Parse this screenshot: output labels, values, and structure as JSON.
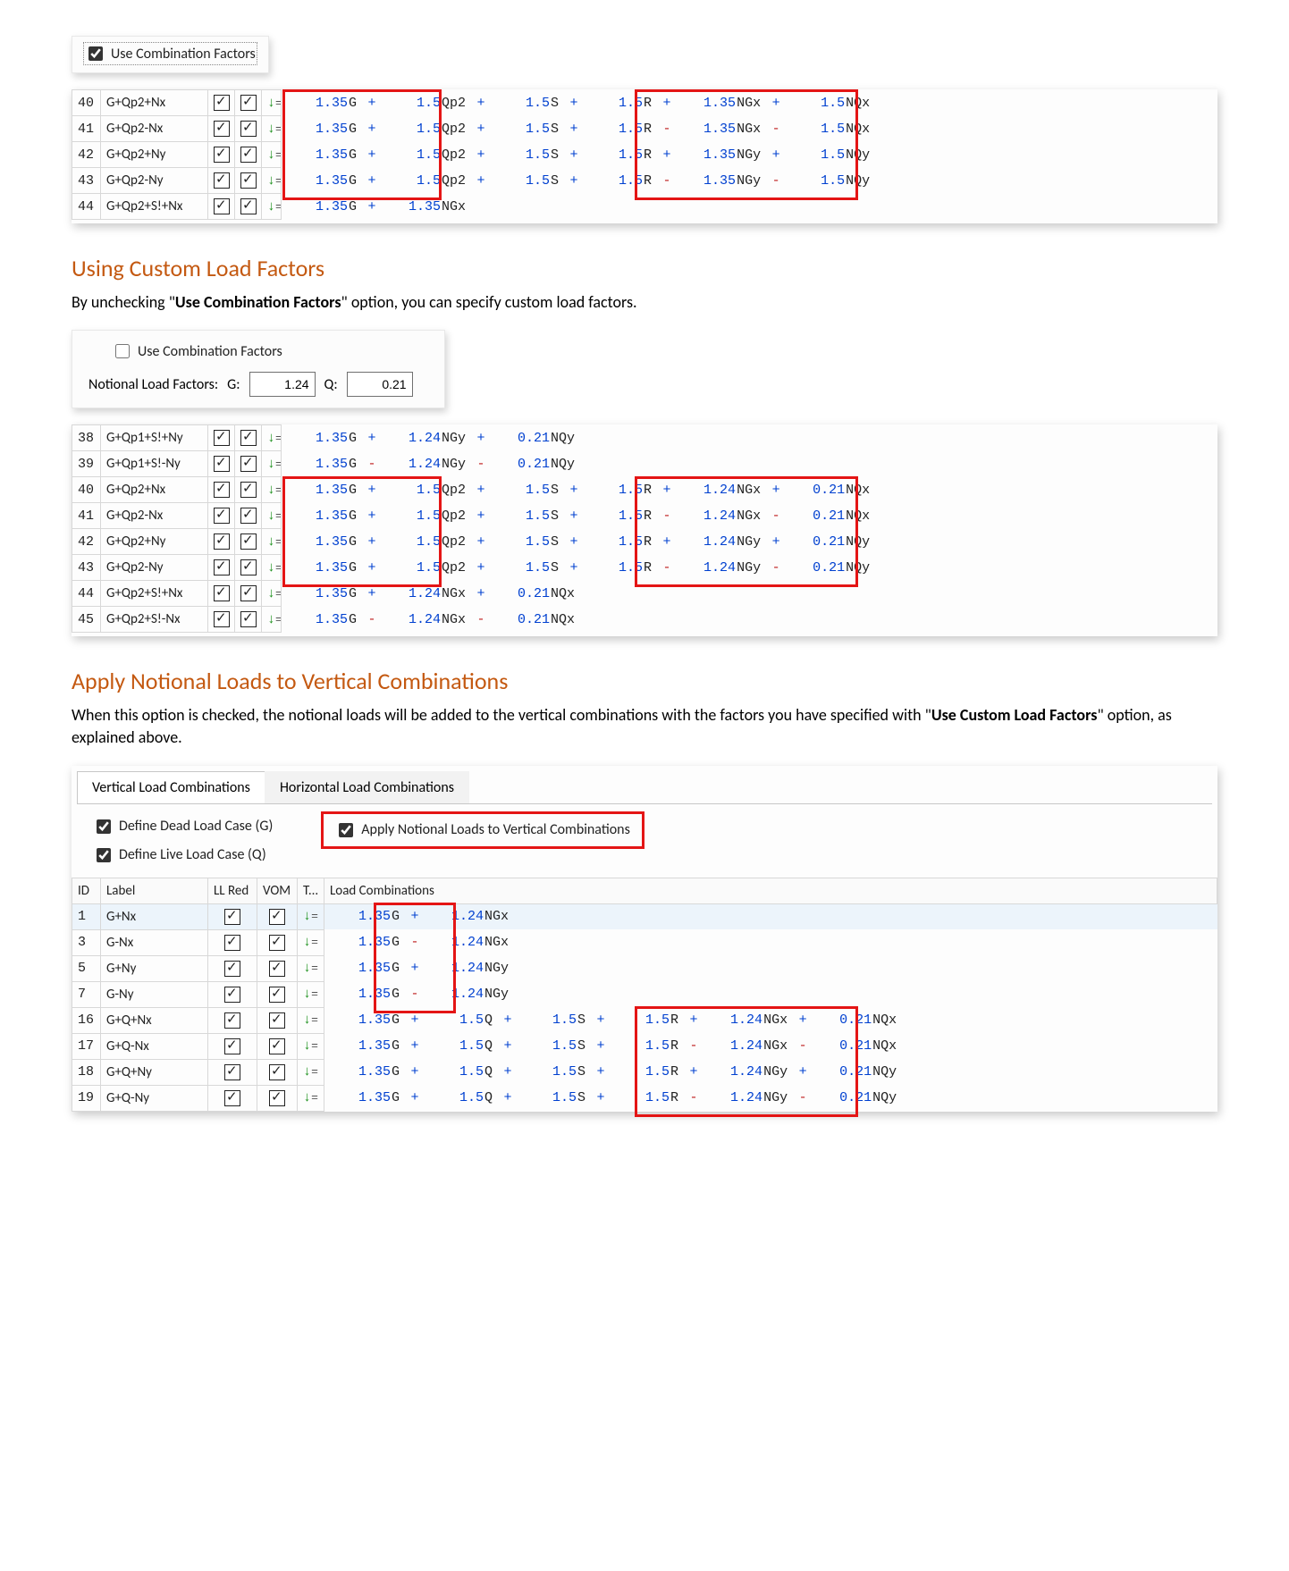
{
  "top_checkbox": {
    "label": "Use Combination Factors",
    "checked": true
  },
  "table1_rows": [
    {
      "id": "40",
      "label": "G+Qp2+Nx",
      "expr": [
        [
          "+",
          "1.35",
          "G"
        ],
        [
          "+",
          "1.5",
          "Qp2"
        ],
        [
          "+",
          "1.5",
          "S"
        ],
        [
          "+",
          "1.5",
          "R"
        ],
        [
          "+",
          "1.35",
          "NGx"
        ],
        [
          "+",
          "1.5",
          "NQx"
        ]
      ]
    },
    {
      "id": "41",
      "label": "G+Qp2-Nx",
      "expr": [
        [
          "+",
          "1.35",
          "G"
        ],
        [
          "+",
          "1.5",
          "Qp2"
        ],
        [
          "+",
          "1.5",
          "S"
        ],
        [
          "+",
          "1.5",
          "R"
        ],
        [
          "-",
          "1.35",
          "NGx"
        ],
        [
          "-",
          "1.5",
          "NQx"
        ]
      ]
    },
    {
      "id": "42",
      "label": "G+Qp2+Ny",
      "expr": [
        [
          "+",
          "1.35",
          "G"
        ],
        [
          "+",
          "1.5",
          "Qp2"
        ],
        [
          "+",
          "1.5",
          "S"
        ],
        [
          "+",
          "1.5",
          "R"
        ],
        [
          "+",
          "1.35",
          "NGy"
        ],
        [
          "+",
          "1.5",
          "NQy"
        ]
      ]
    },
    {
      "id": "43",
      "label": "G+Qp2-Ny",
      "expr": [
        [
          "+",
          "1.35",
          "G"
        ],
        [
          "+",
          "1.5",
          "Qp2"
        ],
        [
          "+",
          "1.5",
          "S"
        ],
        [
          "+",
          "1.5",
          "R"
        ],
        [
          "-",
          "1.35",
          "NGy"
        ],
        [
          "-",
          "1.5",
          "NQy"
        ]
      ]
    },
    {
      "id": "44",
      "label": "G+Qp2+S!+Nx",
      "expr": [
        [
          "+",
          "1.35",
          "G"
        ],
        [
          "+",
          "1.35",
          "NGx"
        ]
      ]
    }
  ],
  "section1": {
    "heading": "Using Custom Load Factors",
    "body_prefix": "By unchecking \"",
    "body_bold": "Use Combination Factors",
    "body_suffix": "\" option, you can specify custom load factors."
  },
  "custom_panel": {
    "checkbox": "Use Combination Factors",
    "checkbox_checked": false,
    "nf_label": "Notional Load Factors:",
    "g_label": "G:",
    "g_val": "1.24",
    "q_label": "Q:",
    "q_val": "0.21"
  },
  "table2_rows": [
    {
      "id": "38",
      "label": "G+Qp1+S!+Ny",
      "expr": [
        [
          "+",
          "1.35",
          "G"
        ],
        [
          "+",
          "1.24",
          "NGy"
        ],
        [
          "+",
          "0.21",
          "NQy"
        ]
      ]
    },
    {
      "id": "39",
      "label": "G+Qp1+S!-Ny",
      "expr": [
        [
          "+",
          "1.35",
          "G"
        ],
        [
          "-",
          "1.24",
          "NGy"
        ],
        [
          "-",
          "0.21",
          "NQy"
        ]
      ]
    },
    {
      "id": "40",
      "label": "G+Qp2+Nx",
      "expr": [
        [
          "+",
          "1.35",
          "G"
        ],
        [
          "+",
          "1.5",
          "Qp2"
        ],
        [
          "+",
          "1.5",
          "S"
        ],
        [
          "+",
          "1.5",
          "R"
        ],
        [
          "+",
          "1.24",
          "NGx"
        ],
        [
          "+",
          "0.21",
          "NQx"
        ]
      ]
    },
    {
      "id": "41",
      "label": "G+Qp2-Nx",
      "expr": [
        [
          "+",
          "1.35",
          "G"
        ],
        [
          "+",
          "1.5",
          "Qp2"
        ],
        [
          "+",
          "1.5",
          "S"
        ],
        [
          "+",
          "1.5",
          "R"
        ],
        [
          "-",
          "1.24",
          "NGx"
        ],
        [
          "-",
          "0.21",
          "NQx"
        ]
      ]
    },
    {
      "id": "42",
      "label": "G+Qp2+Ny",
      "expr": [
        [
          "+",
          "1.35",
          "G"
        ],
        [
          "+",
          "1.5",
          "Qp2"
        ],
        [
          "+",
          "1.5",
          "S"
        ],
        [
          "+",
          "1.5",
          "R"
        ],
        [
          "+",
          "1.24",
          "NGy"
        ],
        [
          "+",
          "0.21",
          "NQy"
        ]
      ]
    },
    {
      "id": "43",
      "label": "G+Qp2-Ny",
      "expr": [
        [
          "+",
          "1.35",
          "G"
        ],
        [
          "+",
          "1.5",
          "Qp2"
        ],
        [
          "+",
          "1.5",
          "S"
        ],
        [
          "+",
          "1.5",
          "R"
        ],
        [
          "-",
          "1.24",
          "NGy"
        ],
        [
          "-",
          "0.21",
          "NQy"
        ]
      ]
    },
    {
      "id": "44",
      "label": "G+Qp2+S!+Nx",
      "expr": [
        [
          "+",
          "1.35",
          "G"
        ],
        [
          "+",
          "1.24",
          "NGx"
        ],
        [
          "+",
          "0.21",
          "NQx"
        ]
      ]
    },
    {
      "id": "45",
      "label": "G+Qp2+S!-Nx",
      "expr": [
        [
          "+",
          "1.35",
          "G"
        ],
        [
          "-",
          "1.24",
          "NGx"
        ],
        [
          "-",
          "0.21",
          "NQx"
        ]
      ]
    }
  ],
  "section2": {
    "heading": "Apply Notional Loads to Vertical Combinations",
    "body_prefix": "When this option is checked, the notional loads will be added to the vertical combinations with the factors you have specified with \"",
    "body_bold": "Use Custom Load Factors",
    "body_suffix": "\" option, as explained above."
  },
  "tabs_panel": {
    "tab1": "Vertical Load Combinations",
    "tab2": "Horizontal Load Combinations",
    "chk_dead": "Define Dead Load Case (G)",
    "chk_live": "Define Live Load Case (Q)",
    "chk_apply": "Apply Notional Loads to Vertical Combinations"
  },
  "table3_headers": {
    "id": "ID",
    "label": "Label",
    "llred": "LL Red",
    "vom": "VOM",
    "t": "T...",
    "lc": "Load Combinations"
  },
  "table3_rows": [
    {
      "id": "1",
      "label": "G+Nx",
      "sel": true,
      "expr": [
        [
          "+",
          "1.35",
          "G"
        ],
        [
          "+",
          "1.24",
          "NGx"
        ]
      ]
    },
    {
      "id": "3",
      "label": "G-Nx",
      "expr": [
        [
          "+",
          "1.35",
          "G"
        ],
        [
          "-",
          "1.24",
          "NGx"
        ]
      ]
    },
    {
      "id": "5",
      "label": "G+Ny",
      "expr": [
        [
          "+",
          "1.35",
          "G"
        ],
        [
          "+",
          "1.24",
          "NGy"
        ]
      ]
    },
    {
      "id": "7",
      "label": "G-Ny",
      "expr": [
        [
          "+",
          "1.35",
          "G"
        ],
        [
          "-",
          "1.24",
          "NGy"
        ]
      ]
    },
    {
      "id": "16",
      "label": "G+Q+Nx",
      "expr": [
        [
          "+",
          "1.35",
          "G"
        ],
        [
          "+",
          "1.5",
          "Q"
        ],
        [
          "+",
          "1.5",
          "S"
        ],
        [
          "+",
          "1.5",
          "R"
        ],
        [
          "+",
          "1.24",
          "NGx"
        ],
        [
          "+",
          "0.21",
          "NQx"
        ]
      ]
    },
    {
      "id": "17",
      "label": "G+Q-Nx",
      "expr": [
        [
          "+",
          "1.35",
          "G"
        ],
        [
          "+",
          "1.5",
          "Q"
        ],
        [
          "+",
          "1.5",
          "S"
        ],
        [
          "+",
          "1.5",
          "R"
        ],
        [
          "-",
          "1.24",
          "NGx"
        ],
        [
          "-",
          "0.21",
          "NQx"
        ]
      ]
    },
    {
      "id": "18",
      "label": "G+Q+Ny",
      "expr": [
        [
          "+",
          "1.35",
          "G"
        ],
        [
          "+",
          "1.5",
          "Q"
        ],
        [
          "+",
          "1.5",
          "S"
        ],
        [
          "+",
          "1.5",
          "R"
        ],
        [
          "+",
          "1.24",
          "NGy"
        ],
        [
          "+",
          "0.21",
          "NQy"
        ]
      ]
    },
    {
      "id": "19",
      "label": "G+Q-Ny",
      "expr": [
        [
          "+",
          "1.35",
          "G"
        ],
        [
          "+",
          "1.5",
          "Q"
        ],
        [
          "+",
          "1.5",
          "S"
        ],
        [
          "+",
          "1.5",
          "R"
        ],
        [
          "-",
          "1.24",
          "NGy"
        ],
        [
          "-",
          "0.21",
          "NQy"
        ]
      ]
    }
  ],
  "hl": {
    "color": "#e41515"
  }
}
